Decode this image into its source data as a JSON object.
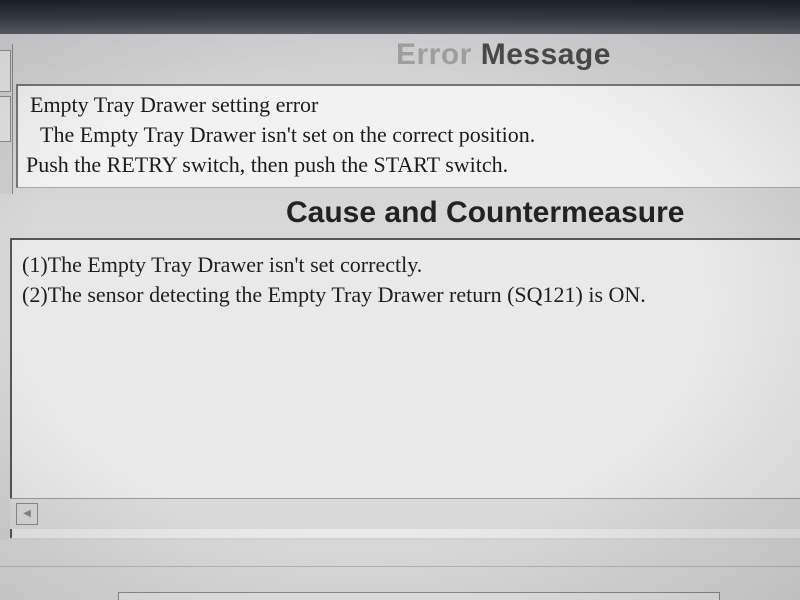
{
  "error_message": {
    "title_faded": "Error ",
    "title_bold": "Message",
    "lines": [
      "Empty Tray Drawer setting error",
      "The Empty Tray Drawer isn't set on the correct position.",
      "Push the RETRY switch, then push the START switch."
    ]
  },
  "cause": {
    "title": "Cause and Countermeasure",
    "lines": [
      "(1)The Empty Tray Drawer isn't set correctly.",
      "(2)The sensor detecting the Empty Tray Drawer return (SQ121) is ON."
    ]
  },
  "icons": {
    "scroll_left": "scroll-left-arrow-icon",
    "scroll_left_glyph": "◀"
  }
}
